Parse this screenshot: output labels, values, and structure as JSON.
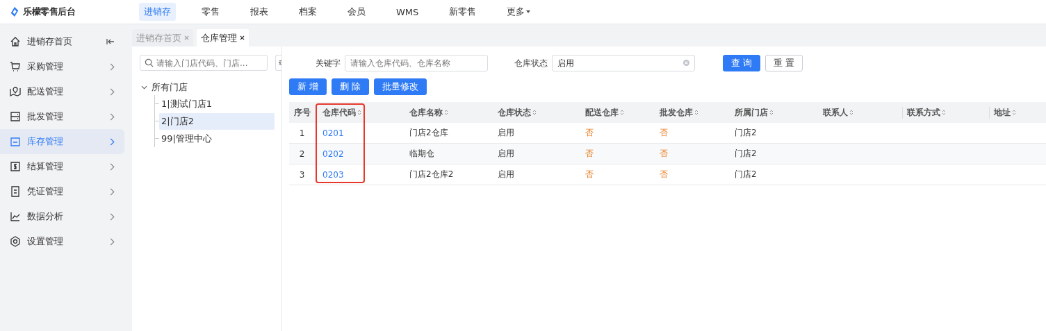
{
  "brand": "乐檬零售后台",
  "nav": [
    {
      "label": "进销存",
      "selected": true
    },
    {
      "label": "零售",
      "selected": false
    },
    {
      "label": "报表",
      "selected": false
    },
    {
      "label": "档案",
      "selected": false
    },
    {
      "label": "会员",
      "selected": false
    },
    {
      "label": "WMS",
      "selected": false
    },
    {
      "label": "新零售",
      "selected": false
    },
    {
      "label": "更多",
      "selected": false,
      "dropdown": true
    }
  ],
  "sidebar": {
    "items": [
      {
        "label": "进销存首页",
        "selected": false
      },
      {
        "label": "采购管理",
        "selected": false
      },
      {
        "label": "配送管理",
        "selected": false
      },
      {
        "label": "批发管理",
        "selected": false
      },
      {
        "label": "库存管理",
        "selected": true
      },
      {
        "label": "结算管理",
        "selected": false
      },
      {
        "label": "凭证管理",
        "selected": false
      },
      {
        "label": "数据分析",
        "selected": false
      },
      {
        "label": "设置管理",
        "selected": false
      }
    ]
  },
  "tabs": [
    {
      "label": "进销存首页",
      "selected": false
    },
    {
      "label": "仓库管理",
      "selected": true
    }
  ],
  "tree": {
    "search_placeholder": "请输入门店代码、门店...",
    "root": {
      "label": "所有门店",
      "expanded": true,
      "children": [
        {
          "label": "1|测试门店1",
          "selected": false
        },
        {
          "label": "2|门店2",
          "selected": true
        },
        {
          "label": "99|管理中心",
          "selected": false
        }
      ]
    }
  },
  "filters": [
    {
      "label": "关键字",
      "placeholder": "请输入仓库代码、仓库名称"
    },
    {
      "label": "仓库状态",
      "value": "启用",
      "clearable": true
    }
  ],
  "search_buttons": [
    {
      "label": "查 询",
      "kind": "primary"
    },
    {
      "label": "重 置",
      "kind": "default"
    }
  ],
  "actions": [
    "新 增",
    "删 除",
    "批量修改"
  ],
  "table": {
    "columns": [
      {
        "label": "序号",
        "sortable": false,
        "highlighted": false
      },
      {
        "label": "仓库代码",
        "sortable": true,
        "highlighted": true
      },
      {
        "label": "仓库名称",
        "sortable": true,
        "highlighted": false
      },
      {
        "label": "仓库状态",
        "sortable": true,
        "highlighted": false
      },
      {
        "label": "配送仓库",
        "sortable": true,
        "highlighted": false
      },
      {
        "label": "批发仓库",
        "sortable": true,
        "highlighted": false
      },
      {
        "label": "所属门店",
        "sortable": true,
        "highlighted": false
      },
      {
        "label": "联系人",
        "sortable": true,
        "highlighted": false
      },
      {
        "label": "联系方式",
        "sortable": true,
        "highlighted": false
      },
      {
        "label": "地址",
        "sortable": true,
        "highlighted": false
      }
    ],
    "rows": [
      [
        "1",
        "0201",
        "门店2仓库",
        "启用",
        "否",
        "否",
        "门店2"
      ],
      [
        "2",
        "0202",
        "临期仓",
        "启用",
        "否",
        "否",
        "门店2"
      ],
      [
        "3",
        "0203",
        "门店2仓库2",
        "启用",
        "否",
        "否",
        "门店2"
      ]
    ]
  }
}
